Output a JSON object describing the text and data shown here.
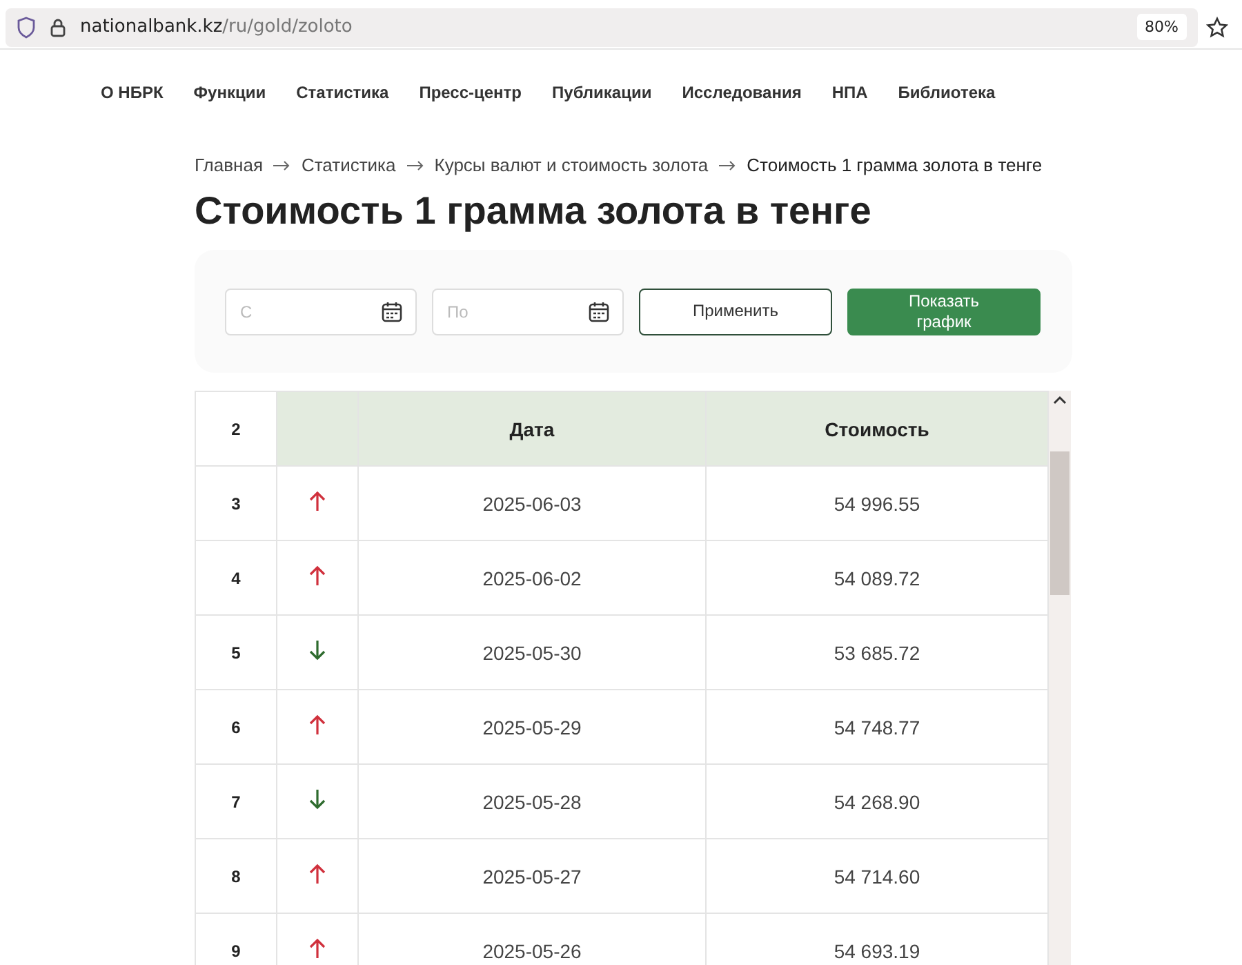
{
  "browser": {
    "url_host": "nationalbank.kz",
    "url_path": "/ru/gold/zoloto",
    "zoom": "80%"
  },
  "nav": [
    "О НБРК",
    "Функции",
    "Статистика",
    "Пресс-центр",
    "Публикации",
    "Исследования",
    "НПА",
    "Библиотека"
  ],
  "breadcrumbs": [
    "Главная",
    "Статистика",
    "Курсы валют и стоимость золота",
    "Стоимость 1 грамма золота в тенге"
  ],
  "title": "Стоимость 1 грамма золота в тенге",
  "filters": {
    "from": {
      "placeholder": "С"
    },
    "to": {
      "placeholder": "По"
    },
    "apply": "Применить",
    "chart": "Показать график"
  },
  "table": {
    "header_number": "2",
    "columns": [
      "Дата",
      "Стоимость"
    ],
    "rows": [
      {
        "number": "3",
        "rising": true,
        "date": "2025-06-03",
        "value": "54 996.55"
      },
      {
        "number": "4",
        "rising": true,
        "date": "2025-06-02",
        "value": "54 089.72"
      },
      {
        "number": "5",
        "rising": false,
        "date": "2025-05-30",
        "value": "53 685.72"
      },
      {
        "number": "6",
        "rising": true,
        "date": "2025-05-29",
        "value": "54 748.77"
      },
      {
        "number": "7",
        "rising": false,
        "date": "2025-05-28",
        "value": "54 268.90"
      },
      {
        "number": "8",
        "rising": true,
        "date": "2025-05-27",
        "value": "54 714.60"
      },
      {
        "number": "9",
        "rising": true,
        "date": "2025-05-26",
        "value": "54 693.19"
      }
    ]
  }
}
